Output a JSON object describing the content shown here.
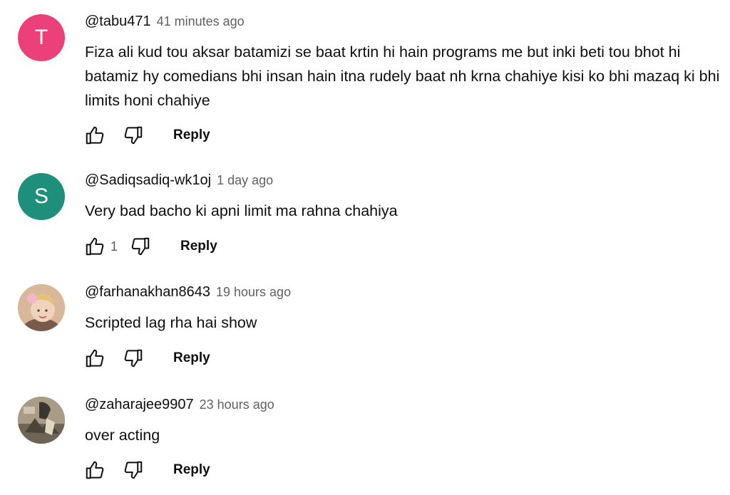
{
  "comments": [
    {
      "author": "@tabu471",
      "time": "41 minutes ago",
      "avatar_letter": "T",
      "avatar_color": "#ec407a",
      "text": "Fiza ali kud tou aksar batamizi se baat krtin hi hain programs me but inki beti tou bhot hi batamiz hy comedians bhi insan hain itna rudely baat nh krna chahiye kisi ko bhi mazaq ki bhi limits honi chahiye",
      "like_count": "",
      "reply_label": "Reply"
    },
    {
      "author": "@Sadiqsadiq-wk1oj",
      "time": "1 day ago",
      "avatar_letter": "S",
      "avatar_color": "#1e8f7a",
      "text": "Very bad bacho ki apni limit ma rahna chahiya",
      "like_count": "1",
      "reply_label": "Reply"
    },
    {
      "author": "@farhanakhan8643",
      "time": "19 hours ago",
      "avatar_letter": "",
      "avatar_color": "#c9a58a",
      "text": "Scripted lag rha hai show",
      "like_count": "",
      "reply_label": "Reply"
    },
    {
      "author": "@zaharajee9907",
      "time": "23 hours ago",
      "avatar_letter": "",
      "avatar_color": "#8c8270",
      "text": "over acting",
      "like_count": "",
      "reply_label": "Reply"
    }
  ],
  "icons": {
    "like": "thumbs-up-icon",
    "dislike": "thumbs-down-icon"
  }
}
